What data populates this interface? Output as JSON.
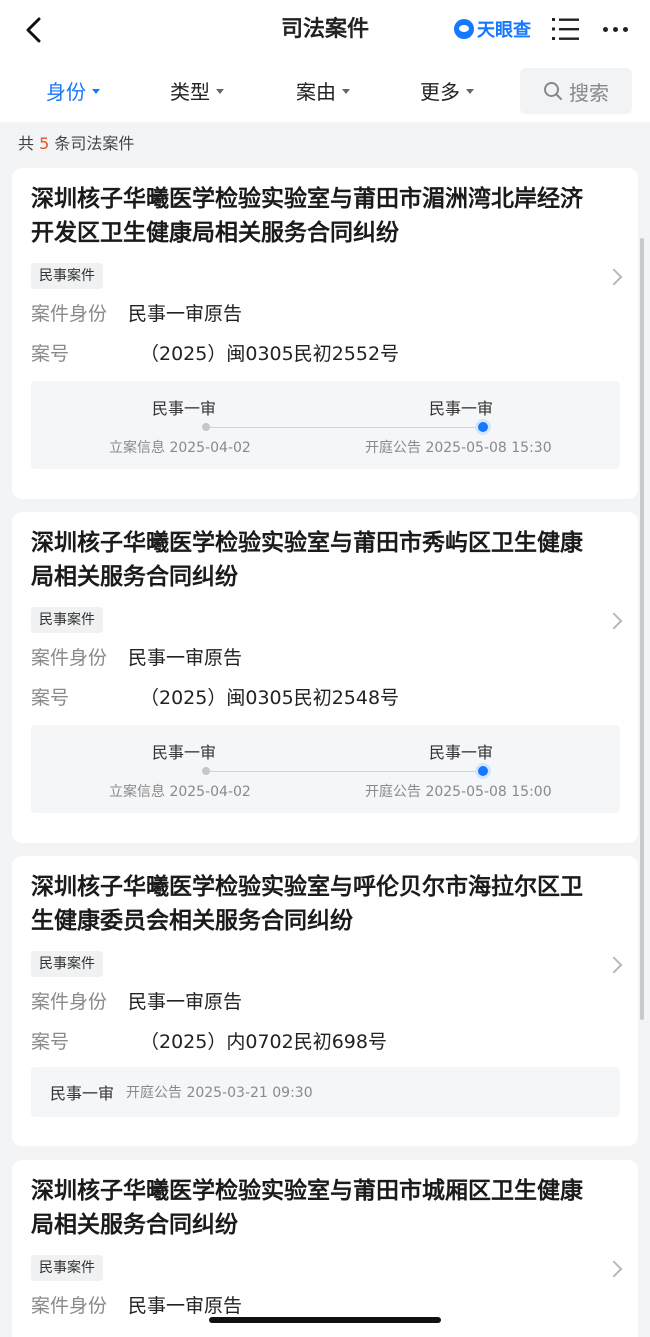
{
  "header": {
    "title": "司法案件",
    "brand": "天眼查"
  },
  "filters": {
    "items": [
      {
        "label": "身份",
        "active": true
      },
      {
        "label": "类型",
        "active": false
      },
      {
        "label": "案由",
        "active": false
      },
      {
        "label": "更多",
        "active": false
      }
    ],
    "search_label": "搜索"
  },
  "count": {
    "prefix": "共",
    "number": "5",
    "suffix": "条司法案件"
  },
  "labels": {
    "identity": "案件身份",
    "case_no": "案号"
  },
  "cases": [
    {
      "title": "深圳核子华曦医学检验实验室与莆田市湄洲湾北岸经济开发区卫生健康局相关服务合同纠纷",
      "tag": "民事案件",
      "identity": "民事一审原告",
      "case_no": "（2025）闽0305民初2552号",
      "timeline": {
        "stage1": "民事一审",
        "info1": "立案信息 2025-04-02",
        "stage2": "民事一审",
        "info2": "开庭公告 2025-05-08 15:30"
      }
    },
    {
      "title": "深圳核子华曦医学检验实验室与莆田市秀屿区卫生健康局相关服务合同纠纷",
      "tag": "民事案件",
      "identity": "民事一审原告",
      "case_no": "（2025）闽0305民初2548号",
      "timeline": {
        "stage1": "民事一审",
        "info1": "立案信息 2025-04-02",
        "stage2": "民事一审",
        "info2": "开庭公告 2025-05-08 15:00"
      }
    },
    {
      "title": "深圳核子华曦医学检验实验室与呼伦贝尔市海拉尔区卫生健康委员会相关服务合同纠纷",
      "tag": "民事案件",
      "identity": "民事一审原告",
      "case_no": "（2025）内0702民初698号",
      "timeline_single": {
        "stage": "民事一审",
        "info": "开庭公告 2025-03-21 09:30"
      }
    },
    {
      "title": "深圳核子华曦医学检验实验室与莆田市城厢区卫生健康局相关服务合同纠纷",
      "tag": "民事案件",
      "identity": "民事一审原告"
    }
  ]
}
